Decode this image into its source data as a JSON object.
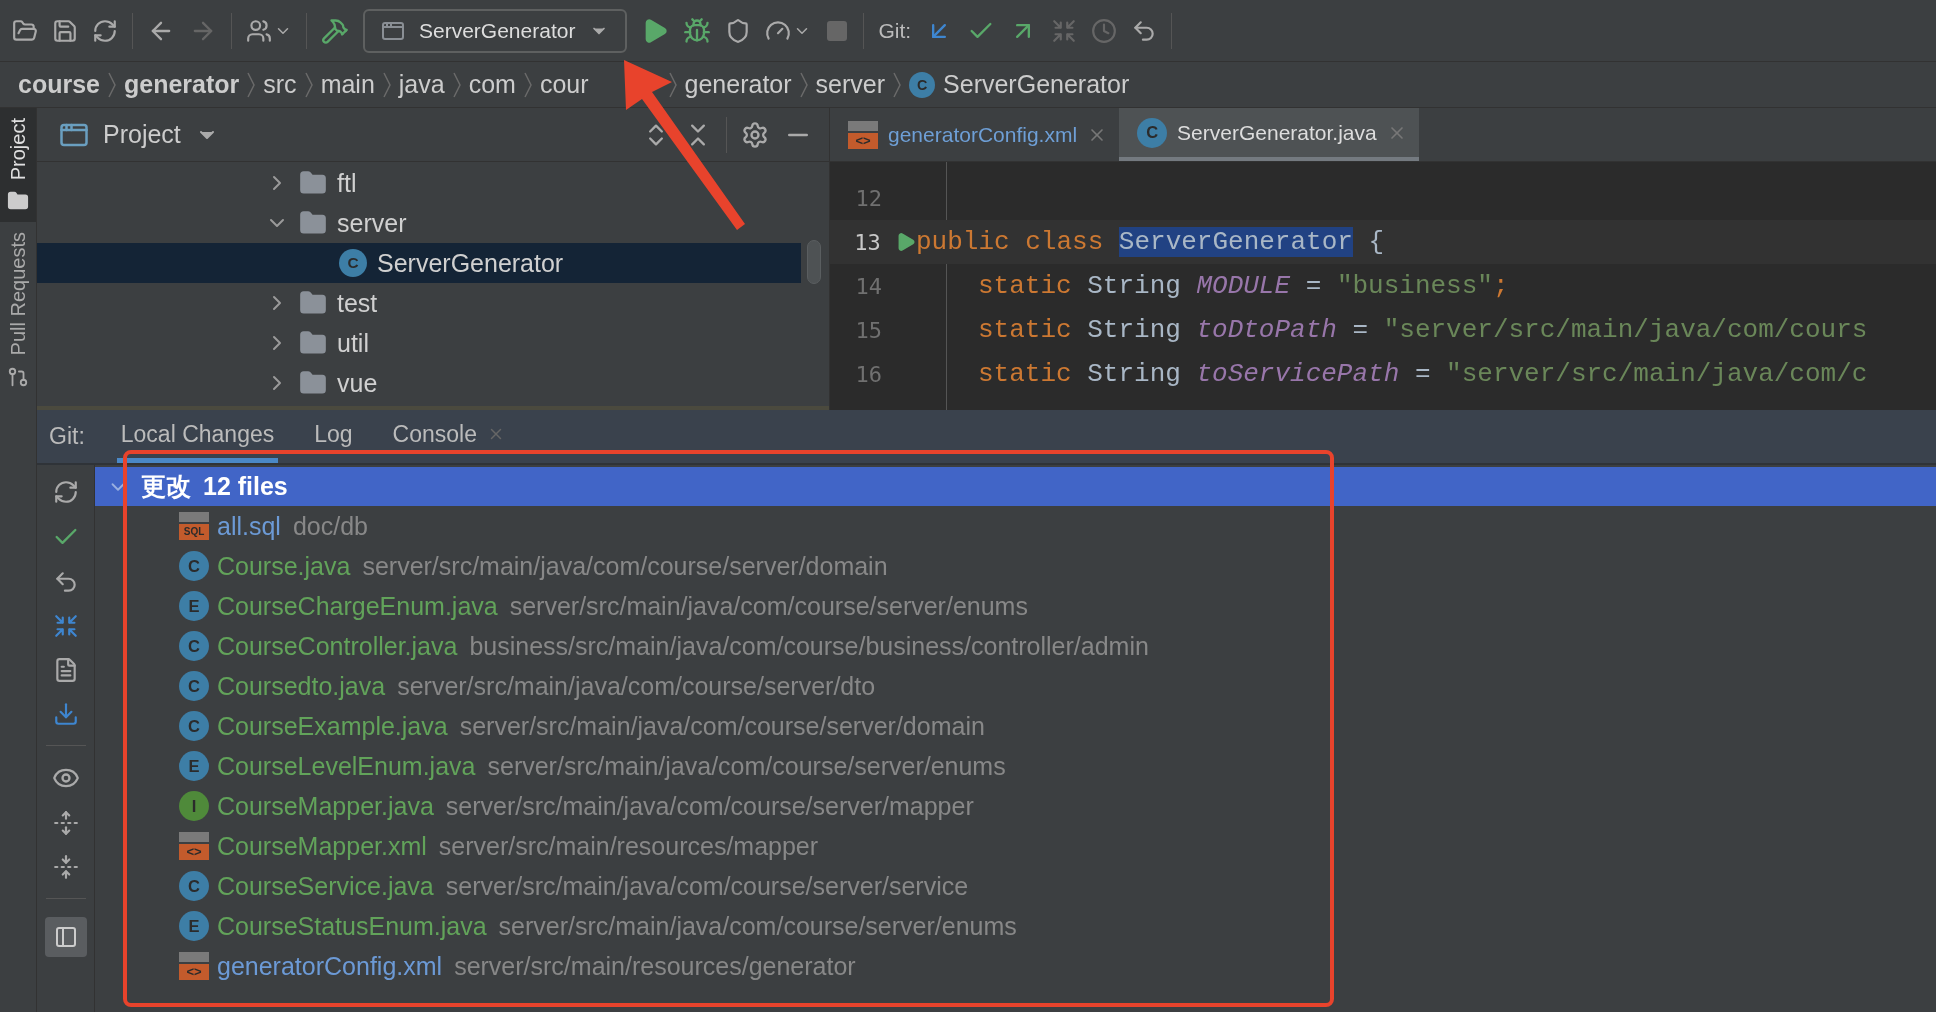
{
  "toolbar": {
    "run_config": "ServerGenerator",
    "git_label": "Git:"
  },
  "breadcrumb": [
    {
      "label": "course",
      "kind": "module"
    },
    {
      "label": "generator",
      "kind": "module"
    },
    {
      "label": "src",
      "kind": "dir"
    },
    {
      "label": "main",
      "kind": "dir"
    },
    {
      "label": "java",
      "kind": "dir"
    },
    {
      "label": "com",
      "kind": "dir"
    },
    {
      "label": "cour",
      "kind": "dir"
    },
    {
      "label": "generator",
      "kind": "dir"
    },
    {
      "label": "server",
      "kind": "dir"
    },
    {
      "label": "ServerGenerator",
      "kind": "class",
      "icon_text": "C"
    }
  ],
  "side_tabs": [
    {
      "label": "Project",
      "selected": true
    },
    {
      "label": "Pull Requests",
      "selected": false
    }
  ],
  "project": {
    "title": "Project",
    "tree": [
      {
        "label": "ftl",
        "kind": "folder",
        "expanded": false,
        "selected": false
      },
      {
        "label": "server",
        "kind": "folder",
        "expanded": true,
        "selected": false,
        "children": [
          {
            "label": "ServerGenerator",
            "kind": "class",
            "icon_text": "C",
            "selected": true
          }
        ]
      },
      {
        "label": "test",
        "kind": "folder",
        "expanded": false,
        "selected": false
      },
      {
        "label": "util",
        "kind": "folder",
        "expanded": false,
        "selected": false
      },
      {
        "label": "vue",
        "kind": "folder",
        "expanded": false,
        "selected": false
      }
    ]
  },
  "editor": {
    "tabs": [
      {
        "label": "generatorConfig.xml",
        "kind": "xml",
        "icon_text": "<>",
        "selected": false
      },
      {
        "label": "ServerGenerator.java",
        "kind": "class",
        "icon_text": "C",
        "selected": true
      }
    ],
    "lines": [
      {
        "number": "12",
        "run": false,
        "current": false
      },
      {
        "number": "13",
        "run": true,
        "current": true,
        "tokens": [
          {
            "text": "public class ",
            "kind": "keyword"
          },
          {
            "text": "ServerGenerator",
            "kind": "selected"
          },
          {
            "text": " {",
            "kind": "plain"
          }
        ],
        "children": [
          {
            "number": "14",
            "run": false,
            "current": false,
            "tokens": [
              {
                "text": "static ",
                "kind": "keyword"
              },
              {
                "text": "String ",
                "kind": "plain"
              },
              {
                "text": "MODULE",
                "kind": "field"
              },
              {
                "text": " = ",
                "kind": "plain"
              },
              {
                "text": "\"business\"",
                "kind": "string"
              },
              {
                "text": ";",
                "kind": "keyword"
              }
            ]
          },
          {
            "number": "15",
            "run": false,
            "current": false,
            "tokens": [
              {
                "text": "static ",
                "kind": "keyword"
              },
              {
                "text": "String ",
                "kind": "plain"
              },
              {
                "text": "toDtoPath",
                "kind": "field"
              },
              {
                "text": " = ",
                "kind": "plain"
              },
              {
                "text": "\"server/src/main/java/com/cours",
                "kind": "string"
              }
            ]
          },
          {
            "number": "16",
            "run": false,
            "current": false,
            "tokens": [
              {
                "text": "static ",
                "kind": "keyword"
              },
              {
                "text": "String ",
                "kind": "plain"
              },
              {
                "text": "toServicePath",
                "kind": "field"
              },
              {
                "text": " = ",
                "kind": "plain"
              },
              {
                "text": "\"server/src/main/java/com/c",
                "kind": "string"
              }
            ]
          }
        ]
      }
    ]
  },
  "git": {
    "label": "Git:",
    "tabs": [
      {
        "label": "Local Changes",
        "selected": true,
        "closable": false
      },
      {
        "label": "Log",
        "selected": false,
        "closable": false
      },
      {
        "label": "Console",
        "selected": false,
        "closable": true
      }
    ],
    "changelist": {
      "name": "更改",
      "count": "12 files",
      "expanded": true,
      "selected": true,
      "files": [
        {
          "name": "all.sql",
          "path": "doc/db",
          "kind": "sql",
          "icon_text": "SQL",
          "color": "#6c9ad6"
        },
        {
          "name": "Course.java",
          "path": "server/src/main/java/com/course/server/domain",
          "kind": "class",
          "icon_text": "C",
          "color": "#62a35a"
        },
        {
          "name": "CourseChargeEnum.java",
          "path": "server/src/main/java/com/course/server/enums",
          "kind": "enum",
          "icon_text": "E",
          "color": "#62a35a"
        },
        {
          "name": "CourseController.java",
          "path": "business/src/main/java/com/course/business/controller/admin",
          "kind": "class",
          "icon_text": "C",
          "color": "#62a35a"
        },
        {
          "name": "Coursedto.java",
          "path": "server/src/main/java/com/course/server/dto",
          "kind": "class",
          "icon_text": "C",
          "color": "#62a35a"
        },
        {
          "name": "CourseExample.java",
          "path": "server/src/main/java/com/course/server/domain",
          "kind": "class",
          "icon_text": "C",
          "color": "#62a35a"
        },
        {
          "name": "CourseLevelEnum.java",
          "path": "server/src/main/java/com/course/server/enums",
          "kind": "enum",
          "icon_text": "E",
          "color": "#62a35a"
        },
        {
          "name": "CourseMapper.java",
          "path": "server/src/main/java/com/course/server/mapper",
          "kind": "interface",
          "icon_text": "I",
          "color": "#62a35a"
        },
        {
          "name": "CourseMapper.xml",
          "path": "server/src/main/resources/mapper",
          "kind": "xml",
          "icon_text": "<>",
          "color": "#62a35a"
        },
        {
          "name": "CourseService.java",
          "path": "server/src/main/java/com/course/server/service",
          "kind": "class",
          "icon_text": "C",
          "color": "#62a35a"
        },
        {
          "name": "CourseStatusEnum.java",
          "path": "server/src/main/java/com/course/server/enums",
          "kind": "enum",
          "icon_text": "E",
          "color": "#62a35a"
        },
        {
          "name": "generatorConfig.xml",
          "path": "server/src/main/resources/generator",
          "kind": "xml",
          "icon_text": "<>",
          "color": "#6c9ad6"
        }
      ]
    }
  }
}
